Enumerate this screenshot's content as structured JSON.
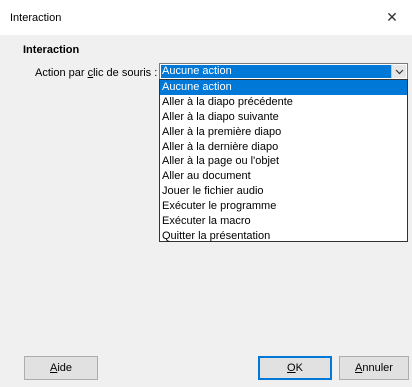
{
  "window": {
    "title": "Interaction",
    "close_glyph": "✕"
  },
  "section": {
    "title": "Interaction",
    "action_label_pre": "Action par ",
    "action_label_underlined": "c",
    "action_label_post": "lic de souris :"
  },
  "combo": {
    "selected_value": "Aucune action",
    "arrow_icon": "chevron-down-icon"
  },
  "dropdown": {
    "items": [
      {
        "label": "Aucune action",
        "selected": true
      },
      {
        "label": "Aller à la diapo précédente",
        "selected": false
      },
      {
        "label": "Aller à la diapo suivante",
        "selected": false
      },
      {
        "label": "Aller à la première diapo",
        "selected": false
      },
      {
        "label": "Aller à la dernière diapo",
        "selected": false
      },
      {
        "label": "Aller à la page ou l'objet",
        "selected": false
      },
      {
        "label": "Aller au document",
        "selected": false
      },
      {
        "label": "Jouer le fichier audio",
        "selected": false
      },
      {
        "label": "Exécuter le programme",
        "selected": false
      },
      {
        "label": "Exécuter la macro",
        "selected": false
      },
      {
        "label": "Quitter la présentation",
        "selected": false
      }
    ]
  },
  "buttons": {
    "help_underlined": "A",
    "help_rest": "ide",
    "ok_underlined": "O",
    "ok_rest": "K",
    "cancel_underlined": "A",
    "cancel_rest": "nnuler"
  },
  "colors": {
    "accent": "#0078d7",
    "background": "#f0f0f0"
  }
}
